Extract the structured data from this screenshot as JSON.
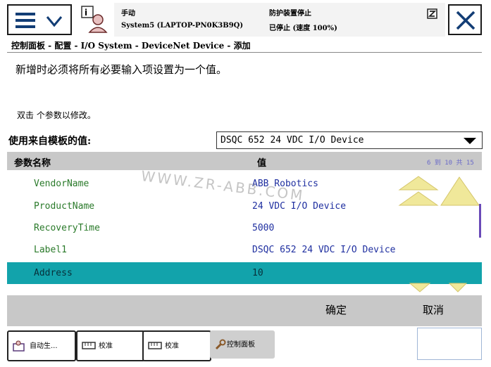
{
  "header": {
    "mode": "手动",
    "system": "System5 (LAPTOP-PN0K3B9Q)",
    "safety": "防护装置停止",
    "state": "已停止 (速度 100%)"
  },
  "breadcrumb": "控制面板 - 配置 - I/O System - DeviceNet Device - 添加",
  "instruction": "新增时必须将所有必要输入项设置为一个值。",
  "hint": "双击  个参数以修改。",
  "template": {
    "label": "使用来自模板的值:",
    "selected": "DSQC 652 24 VDC I/O Device"
  },
  "table": {
    "headers": {
      "name": "参数名称",
      "value": "值"
    },
    "range": "6 到 10 共 15",
    "rows": [
      {
        "name": "VendorName",
        "value": "ABB Robotics"
      },
      {
        "name": "ProductName",
        "value": "24 VDC I/O Device"
      },
      {
        "name": "RecoveryTime",
        "value": "5000"
      },
      {
        "name": "Label1",
        "value": "DSQC 652 24 VDC I/O Device"
      },
      {
        "name": "Address",
        "value": "10"
      }
    ]
  },
  "watermark": "WWW.ZR-ABB.COM",
  "buttons": {
    "ok": "确定",
    "cancel": "取消"
  },
  "taskbar": [
    {
      "label": "自动生...",
      "icon": "auto-produce-icon"
    },
    {
      "label": "校准",
      "icon": "calibration-icon"
    },
    {
      "label": "校准",
      "icon": "calibration-icon"
    },
    {
      "label": "控制面板",
      "icon": "wrench-icon"
    }
  ],
  "colors": {
    "selected_row": "#12a3ab",
    "param_name": "#2a7a2a",
    "param_value": "#1f2fa0",
    "scroll_arrow": "#f0e89a"
  }
}
